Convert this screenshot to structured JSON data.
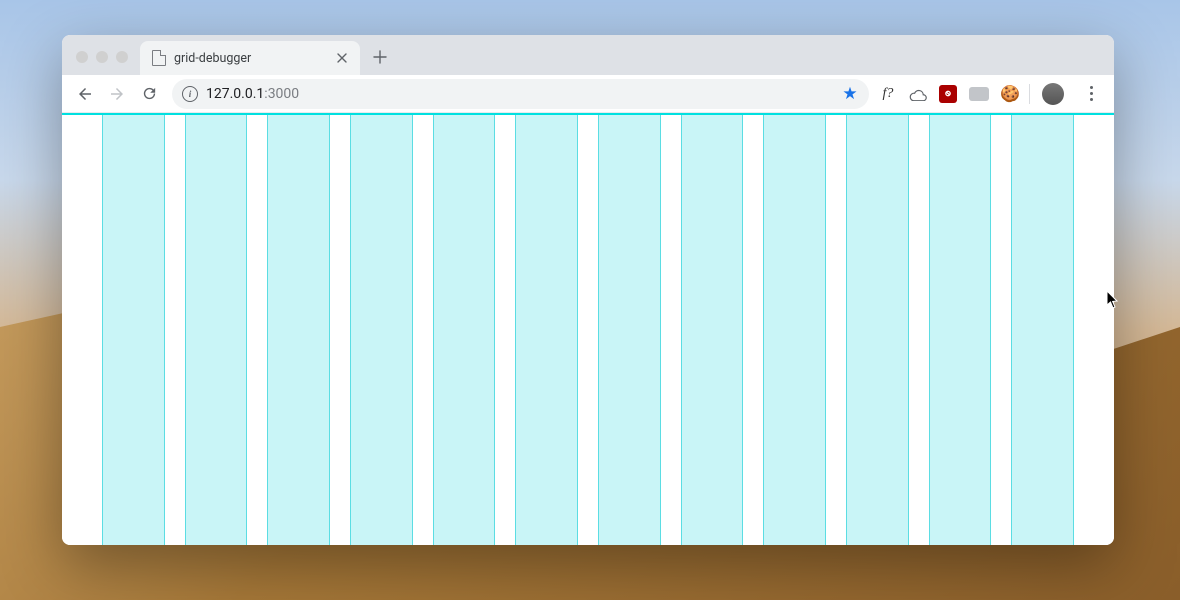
{
  "tab": {
    "title": "grid-debugger"
  },
  "omnibox": {
    "host": "127.0.0.1",
    "port": ":3000"
  },
  "extensions": {
    "fq_label": "f?"
  },
  "grid": {
    "columns": 12
  }
}
